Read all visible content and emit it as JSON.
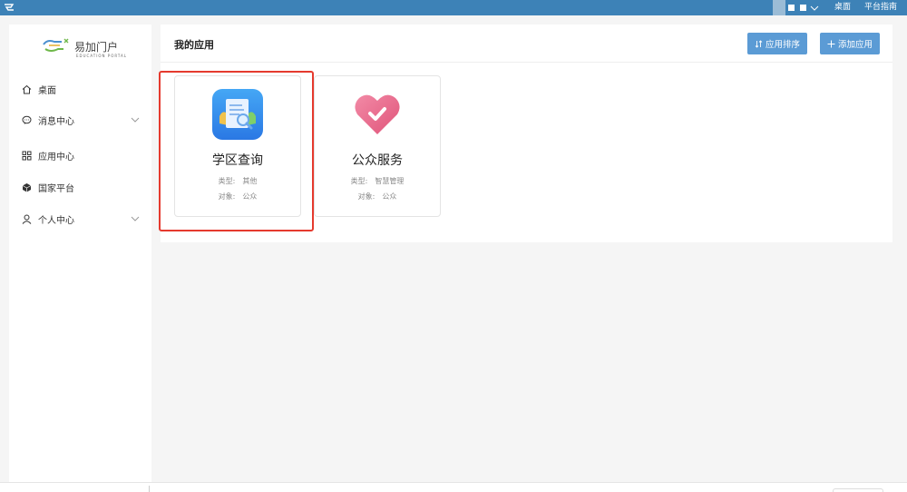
{
  "topbar": {
    "logo_icon": "portal-logo-icon",
    "user_menu_icon": "chevron-down-icon",
    "desktop_link": "桌面",
    "guide_link": "平台指南",
    "bg_color": "#3d82b7"
  },
  "sidebar": {
    "brand_name": "易加门户",
    "brand_sub": "EDUCATION PORTAL",
    "items": [
      {
        "label": "桌面",
        "icon": "home-icon",
        "expandable": false
      },
      {
        "label": "消息中心",
        "icon": "message-icon",
        "expandable": true
      },
      {
        "label": "应用中心",
        "icon": "grid-icon",
        "expandable": false
      },
      {
        "label": "国家平台",
        "icon": "cube-icon",
        "expandable": false
      },
      {
        "label": "个人中心",
        "icon": "user-icon",
        "expandable": true
      }
    ]
  },
  "main": {
    "title": "我的应用",
    "sort_button": "应用排序",
    "add_button": "添加应用",
    "button_color": "#5b9bd5",
    "apps": [
      {
        "name": "学区查询",
        "type_label": "类型:",
        "type_value": "其他",
        "target_label": "对象:",
        "target_value": "公众",
        "icon": "document-search-icon"
      },
      {
        "name": "公众服务",
        "type_label": "类型:",
        "type_value": "智慧管理",
        "target_label": "对象:",
        "target_value": "公众",
        "icon": "heart-check-icon"
      }
    ],
    "highlight_color": "#e53a2e"
  }
}
